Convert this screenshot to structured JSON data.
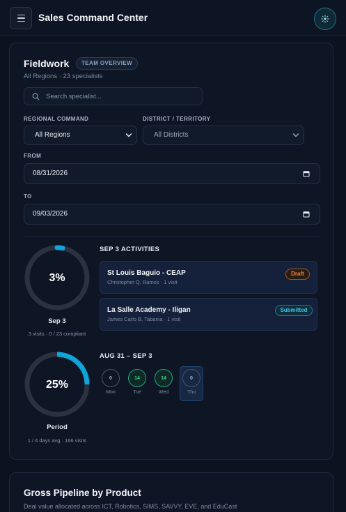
{
  "header": {
    "title": "Sales Command Center"
  },
  "fieldwork": {
    "title": "Fieldwork",
    "badge": "TEAM OVERVIEW",
    "subtitle": "All Regions · 23 specialists",
    "search_placeholder": "Search specialist...",
    "filters": {
      "region_label": "REGIONAL COMMAND",
      "region_value": "All Regions",
      "district_label": "DISTRICT / TERRITORY",
      "district_value": "All Districts",
      "from_label": "FROM",
      "from_value": "08/31/2026",
      "to_label": "TO",
      "to_value": "09/03/2026"
    },
    "daily_ring": {
      "percent_text": "3%",
      "percent": 0.03,
      "label": "Sep 3",
      "sub": "3 visits · 0 / 23 compliant"
    },
    "period_ring": {
      "percent_text": "25%",
      "percent": 0.25,
      "label": "Period",
      "sub": "1 / 4 days avg · 166 visits"
    },
    "activities_heading": "SEP 3 ACTIVITIES",
    "activities": [
      {
        "title": "St Louis Baguio - CEAP",
        "meta": "Christopher Q. Ramos · 1 visit",
        "status": "Draft"
      },
      {
        "title": "La Salle Academy - Iligan",
        "meta": "James Carlo B. Tabania · 1 visit",
        "status": "Submitted"
      }
    ],
    "week_heading": "AUG 31 – SEP 3",
    "week": [
      {
        "count": "0",
        "day": "Mon"
      },
      {
        "count": "14",
        "day": "Tue"
      },
      {
        "count": "14",
        "day": "Wed"
      },
      {
        "count": "0",
        "day": "Thu"
      }
    ]
  },
  "pipeline": {
    "title": "Gross Pipeline by Product",
    "subtitle": "Deal value allocated across ICT, Robotics, SIMS, SAVVY, EVE, and EduCast"
  },
  "colors": {
    "accent": "#0ea5d9",
    "ring_track": "#2a3240",
    "green": "#22a37a",
    "draft": "#f08a3c",
    "submitted": "#3bc6e8"
  }
}
